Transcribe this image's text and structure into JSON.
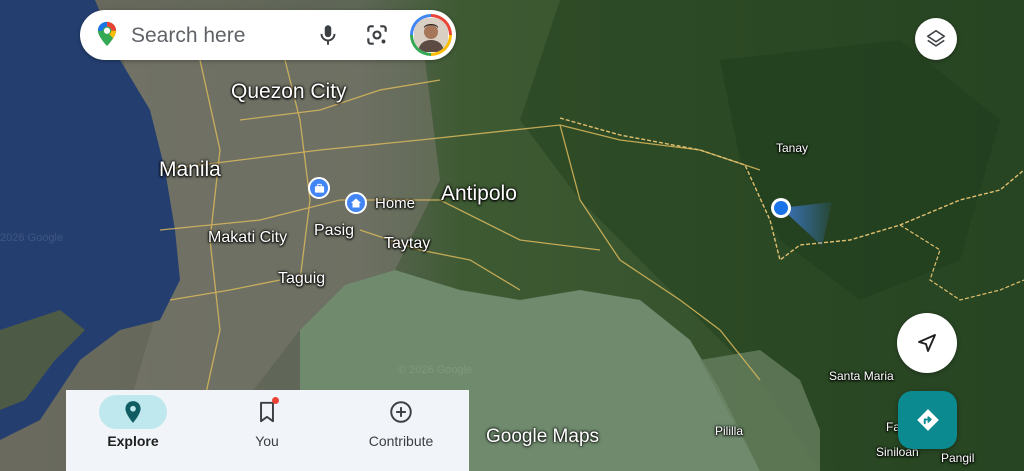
{
  "search": {
    "placeholder": "Search here"
  },
  "places": [
    {
      "name": "Quezon City",
      "size": "big"
    },
    {
      "name": "Manila",
      "size": "big"
    },
    {
      "name": "Antipolo",
      "size": "big"
    },
    {
      "name": "Makati City",
      "size": "mid"
    },
    {
      "name": "Pasig",
      "size": "mid"
    },
    {
      "name": "Taytay",
      "size": "mid"
    },
    {
      "name": "Taguig",
      "size": "mid"
    },
    {
      "name": "Tanay",
      "size": "small"
    },
    {
      "name": "Santa Maria",
      "size": "small"
    },
    {
      "name": "Pililla",
      "size": "small"
    },
    {
      "name": "Fa",
      "size": "small"
    },
    {
      "name": "Siniloan",
      "size": "small"
    },
    {
      "name": "Pangil",
      "size": "small"
    }
  ],
  "saved": {
    "home_label": "Home"
  },
  "watermarks": [
    "2026 Google",
    "© 2026 Google"
  ],
  "brand": {
    "text": "Google Maps"
  },
  "nav": {
    "explore": "Explore",
    "you": "You",
    "contribute": "Contribute",
    "active": "explore"
  },
  "icons": {
    "maps_logo": "maps-pin-logo-icon",
    "mic": "microphone-icon",
    "lens": "camera-lens-icon",
    "avatar": "profile-avatar",
    "layers": "layers-icon",
    "location": "navigation-arrow-icon",
    "directions": "directions-icon",
    "explore": "location-pin-icon",
    "you": "bookmark-icon",
    "contribute": "add-circle-icon",
    "work": "briefcase-icon",
    "home": "home-icon"
  },
  "colors": {
    "accent_teal": "#0b8a8f",
    "location_blue": "#4285f4",
    "nav_active_pill": "#bfe7ee",
    "notification_red": "#ea4335"
  }
}
